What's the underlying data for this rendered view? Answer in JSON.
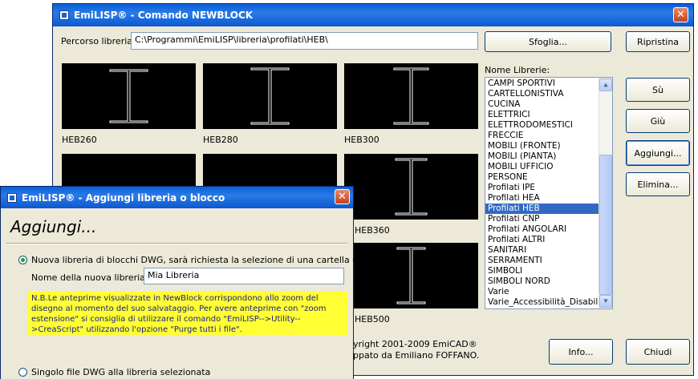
{
  "main_window": {
    "title": "EmiLISP® - Comando NEWBLOCK",
    "path_label": "Percorso libreria:",
    "path_value": "C:\\Programmi\\EmiLISP\\libreria\\profilati\\HEB\\",
    "browse_button": "Sfoglia...",
    "restore_button": "Ripristina",
    "libraries_label": "Nome Librerie:",
    "libraries": [
      "CAMPI SPORTIVI",
      "CARTELLONISTIVA",
      "CUCINA",
      "ELETTRICI",
      "ELETTRODOMESTICI",
      "FRECCIE",
      "MOBILI (FRONTE)",
      "MOBILI (PIANTA)",
      "MOBILI UFFICIO",
      "PERSONE",
      "Profilati IPE",
      "Profilati HEA",
      "Profilati HEB",
      "Profilati CNP",
      "Profilati ANGOLARI",
      "Profilati ALTRI",
      "SANITARI",
      "SERRAMENTI",
      "SIMBOLI",
      "SIMBOLI NORD",
      "Varie",
      "Varie_Accessibilità_Disabili"
    ],
    "selected_library": "Profilati HEB",
    "up_button": "Sù",
    "down_button": "Giù",
    "add_button": "Aggiungi...",
    "delete_button": "Elimina...",
    "info_button": "Info...",
    "close_button": "Chiudi",
    "thumb_labels": [
      "HEB260",
      "HEB280",
      "HEB300",
      "",
      "",
      "HEB360",
      "",
      "",
      "HEB500"
    ],
    "copyright_line1": "yright 2001-2009 EmiCAD®",
    "copyright_line2": "ppato da Emiliano FOFFANO."
  },
  "dialog": {
    "title": "EmiLISP® - Aggiungi libreria o blocco",
    "heading": "Aggiungi...",
    "option1_label": "Nuova libreria di blocchi DWG, sarà richiesta la selezione di una cartella di file",
    "name_label": "Nome della nuova libreria:",
    "name_value": "Mia Libreria",
    "note": "N.B.Le anteprime visualizzate in NewBlock corrispondono allo zoom del disegno al momento del suo salvataggio. Per avere anteprime con \"zoom estensione\" si consiglia di utilizzare il comando \"EmiLISP-->Utility-->CreaScript\" utilizzando l'opzione \"Purge tutti i file\".",
    "option2_label": "Singolo file DWG alla libreria selezionata"
  },
  "colors": {
    "title_blue": "#0b5ed7",
    "selection": "#316ac5",
    "note_bg": "#ffff33"
  }
}
